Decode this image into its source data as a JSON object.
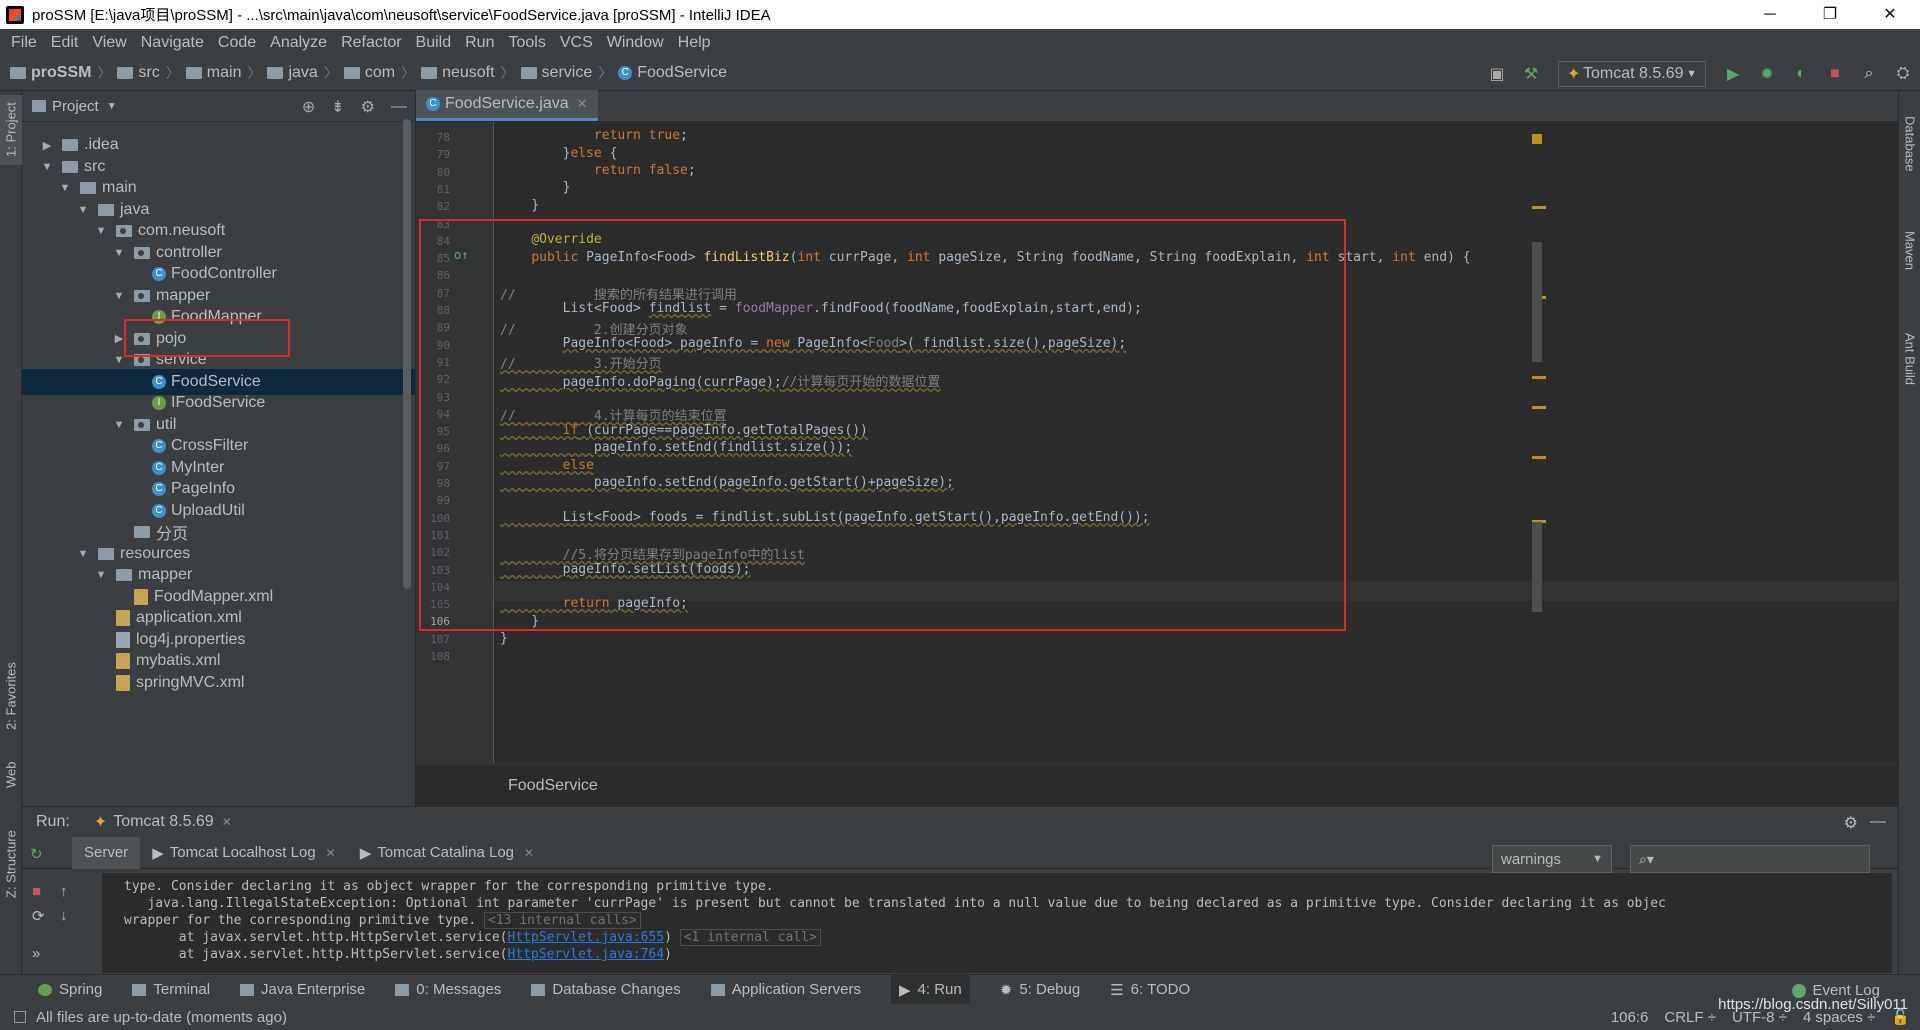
{
  "titlebar": {
    "title": "proSSM [E:\\java项目\\proSSM] - ...\\src\\main\\java\\com\\neusoft\\service\\FoodService.java [proSSM] - IntelliJ IDEA",
    "minimize": "─",
    "maximize": "❐",
    "close": "✕"
  },
  "menu": [
    "File",
    "Edit",
    "View",
    "Navigate",
    "Code",
    "Analyze",
    "Refactor",
    "Build",
    "Run",
    "Tools",
    "VCS",
    "Window",
    "Help"
  ],
  "breadcrumbs": [
    "proSSM",
    "src",
    "main",
    "java",
    "com",
    "neusoft",
    "service",
    "FoodService"
  ],
  "run_config": "Tomcat 8.5.69",
  "left_strip": {
    "project": "1: Project",
    "favorites": "2: Favorites",
    "web": "Web",
    "structure": "Z: Structure"
  },
  "right_strip": {
    "database": "Database",
    "maven": "Maven",
    "ant": "Ant Build"
  },
  "project_panel": {
    "title": "Project",
    "tree": [
      {
        "label": ".idea",
        "depth": 1,
        "arrow": "▶",
        "kind": "folder"
      },
      {
        "label": "src",
        "depth": 1,
        "arrow": "▼",
        "kind": "folder"
      },
      {
        "label": "main",
        "depth": 2,
        "arrow": "▼",
        "kind": "folder"
      },
      {
        "label": "java",
        "depth": 3,
        "arrow": "▼",
        "kind": "folder"
      },
      {
        "label": "com.neusoft",
        "depth": 4,
        "arrow": "▼",
        "kind": "package"
      },
      {
        "label": "controller",
        "depth": 5,
        "arrow": "▼",
        "kind": "package"
      },
      {
        "label": "FoodController",
        "depth": 6,
        "arrow": "",
        "kind": "class"
      },
      {
        "label": "mapper",
        "depth": 5,
        "arrow": "▼",
        "kind": "package"
      },
      {
        "label": "FoodMapper",
        "depth": 6,
        "arrow": "",
        "kind": "interface"
      },
      {
        "label": "pojo",
        "depth": 5,
        "arrow": "▶",
        "kind": "package"
      },
      {
        "label": "service",
        "depth": 5,
        "arrow": "▼",
        "kind": "package"
      },
      {
        "label": "FoodService",
        "depth": 6,
        "arrow": "",
        "kind": "class"
      },
      {
        "label": "IFoodService",
        "depth": 6,
        "arrow": "",
        "kind": "interface"
      },
      {
        "label": "util",
        "depth": 5,
        "arrow": "▼",
        "kind": "package"
      },
      {
        "label": "CrossFilter",
        "depth": 6,
        "arrow": "",
        "kind": "class"
      },
      {
        "label": "MyInter",
        "depth": 6,
        "arrow": "",
        "kind": "class"
      },
      {
        "label": "PageInfo",
        "depth": 6,
        "arrow": "",
        "kind": "class"
      },
      {
        "label": "UploadUtil",
        "depth": 6,
        "arrow": "",
        "kind": "class"
      },
      {
        "label": "分页",
        "depth": 5,
        "arrow": "",
        "kind": "folder"
      },
      {
        "label": "resources",
        "depth": 3,
        "arrow": "▼",
        "kind": "folder"
      },
      {
        "label": "mapper",
        "depth": 4,
        "arrow": "▼",
        "kind": "folder"
      },
      {
        "label": "FoodMapper.xml",
        "depth": 5,
        "arrow": "",
        "kind": "xml"
      },
      {
        "label": "application.xml",
        "depth": 4,
        "arrow": "",
        "kind": "xml"
      },
      {
        "label": "log4j.properties",
        "depth": 4,
        "arrow": "",
        "kind": "prop"
      },
      {
        "label": "mybatis.xml",
        "depth": 4,
        "arrow": "",
        "kind": "xml"
      },
      {
        "label": "springMVC.xml",
        "depth": 4,
        "arrow": "",
        "kind": "xml"
      }
    ],
    "selected_index": 11
  },
  "editor": {
    "tab": "FoodService.java",
    "crumb": "FoodService",
    "current_line": "106",
    "line_numbers": [
      "78",
      "79",
      "80",
      "81",
      "82",
      "83",
      "84",
      "85",
      "86",
      "87",
      "88",
      "89",
      "90",
      "91",
      "92",
      "93",
      "94",
      "95",
      "96",
      "97",
      "98",
      "99",
      "100",
      "101",
      "102",
      "103",
      "104",
      "105",
      "106",
      "107",
      "108"
    ]
  },
  "run_panel": {
    "label": "Run:",
    "config_tab": "Tomcat 8.5.69",
    "tabs": [
      "Server",
      "Tomcat Localhost Log",
      "Tomcat Catalina Log"
    ],
    "filter": "warnings",
    "console": [
      "type. Consider declaring it as object wrapper for the corresponding primitive type.",
      "   java.lang.IllegalStateException: Optional int parameter 'currPage' is present but cannot be translated into a null value due to being declared as a primitive type. Consider declaring it as objec",
      "wrapper for the corresponding primitive type.",
      "       at javax.servlet.http.HttpServlet.service(",
      "       at javax.servlet.http.HttpServlet.service("
    ],
    "fold_13": "<13 internal calls>",
    "fold_1": "<1 internal call>",
    "link1": "HttpServlet.java:655",
    "link2": "HttpServlet.java:764"
  },
  "bottom_tabs": [
    "Spring",
    "Terminal",
    "Java Enterprise",
    "0: Messages",
    "Database Changes",
    "Application Servers",
    "4: Run",
    "5: Debug",
    "6: TODO"
  ],
  "event_log": "Event Log",
  "status": {
    "message": "All files are up-to-date (moments ago)",
    "position": "106:6",
    "line_sep": "CRLF ÷",
    "encoding": "UTF-8 ÷",
    "indent": "4 spaces ÷",
    "watermark": "https://blog.csdn.net/Silly011"
  },
  "colors": {
    "accent": "#4a88c7",
    "highlight_box": "#e2262a",
    "selection": "#0d293e",
    "editor_bg": "#2b2b2b",
    "panel_bg": "#3c3f41"
  }
}
